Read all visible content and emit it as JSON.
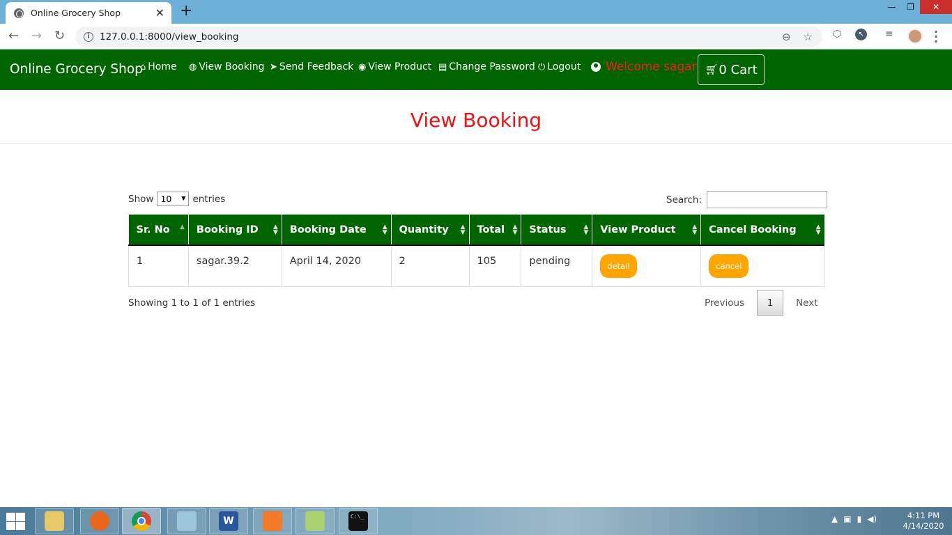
{
  "browser": {
    "tab_title": "Online Grocery Shop",
    "url": "127.0.0.1:8000/view_booking"
  },
  "navbar": {
    "brand": "Online Grocery Shop",
    "items": [
      {
        "label": "Home",
        "icon": "home-icon"
      },
      {
        "label": "View Booking",
        "icon": "dashboard-icon"
      },
      {
        "label": "Send Feedback",
        "icon": "send-icon"
      },
      {
        "label": "View Product",
        "icon": "eye-icon"
      },
      {
        "label": "Change Password",
        "icon": "document-icon"
      },
      {
        "label": "Logout",
        "icon": "power-icon"
      }
    ],
    "welcome": "Welcome sagar",
    "cart_label": "0 Cart",
    "welcome_color": "#ff1a1a",
    "brand_color": "#006400"
  },
  "page": {
    "title": "View Booking"
  },
  "table_controls": {
    "show_label": "Show",
    "entries_label": "entries",
    "page_length": "10",
    "search_label": "Search:",
    "search_value": ""
  },
  "table": {
    "columns": [
      "Sr. No",
      "Booking ID",
      "Booking Date",
      "Quantity",
      "Total",
      "Status",
      "View Product",
      "Cancel Booking"
    ],
    "rows": [
      {
        "sr": "1",
        "booking_id": "sagar.39.2",
        "date": "April 14, 2020",
        "quantity": "2",
        "total": "105",
        "status": "pending",
        "view_label": "detail",
        "cancel_label": "cancel"
      }
    ]
  },
  "footer": {
    "info": "Showing 1 to 1 of 1 entries",
    "previous": "Previous",
    "current_page": "1",
    "next": "Next"
  },
  "taskbar": {
    "time": "4:11 PM",
    "date": "4/14/2020"
  }
}
